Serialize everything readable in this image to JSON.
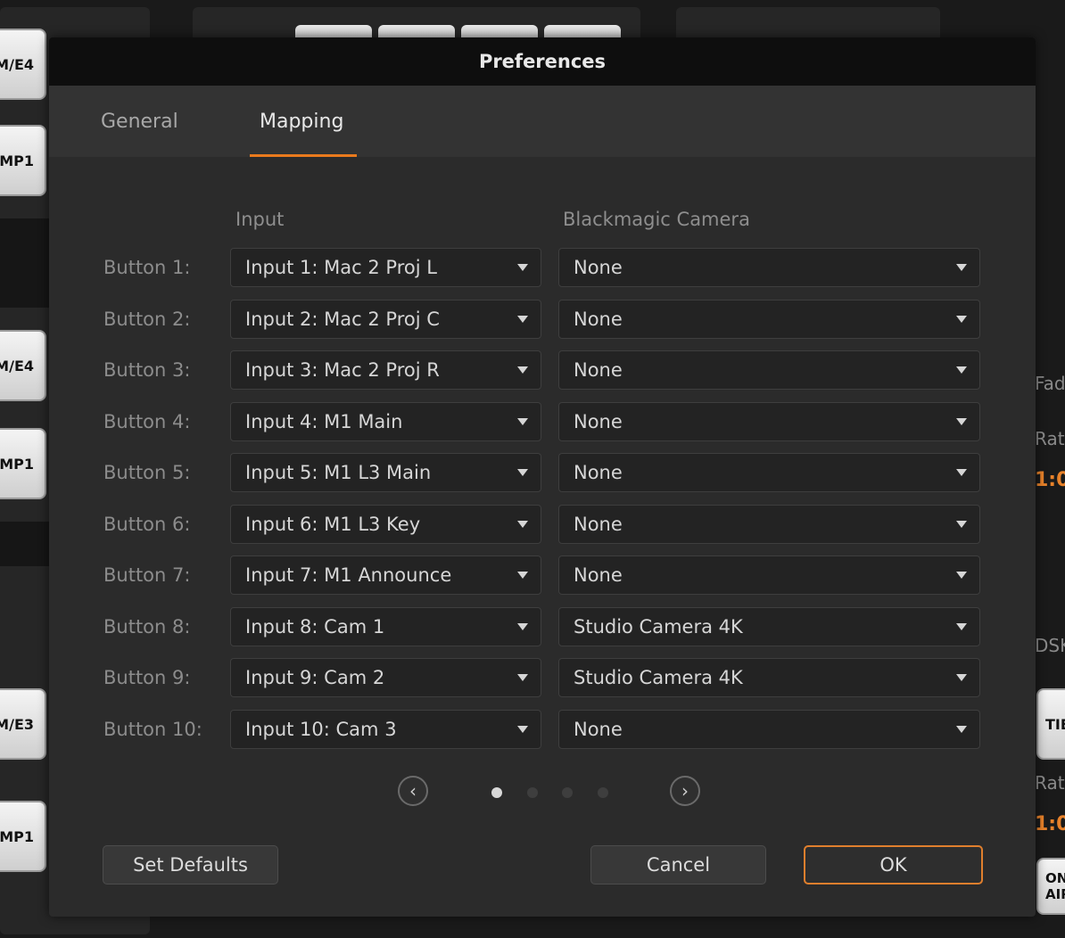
{
  "background": {
    "left_buttons": [
      "M/E4",
      "MP1",
      "M/E4",
      "MP1",
      "M/E3",
      "MP1"
    ],
    "right_labels": [
      "Fad",
      "Rat",
      "DSK",
      "Rat"
    ],
    "right_values": [
      "1:0",
      "1:0"
    ],
    "right_buttons": [
      "TIE",
      "ON AIR"
    ]
  },
  "dialog": {
    "title": "Preferences",
    "tabs": [
      {
        "label": "General",
        "active": false
      },
      {
        "label": "Mapping",
        "active": true
      }
    ],
    "columns": {
      "input": "Input",
      "camera": "Blackmagic Camera"
    },
    "rows": [
      {
        "label": "Button 1:",
        "input": "Input 1: Mac 2 Proj L",
        "camera": "None"
      },
      {
        "label": "Button 2:",
        "input": "Input 2: Mac 2 Proj C",
        "camera": "None"
      },
      {
        "label": "Button 3:",
        "input": "Input 3: Mac 2 Proj R",
        "camera": "None"
      },
      {
        "label": "Button 4:",
        "input": "Input 4: M1 Main",
        "camera": "None"
      },
      {
        "label": "Button 5:",
        "input": "Input 5: M1 L3 Main",
        "camera": "None"
      },
      {
        "label": "Button 6:",
        "input": "Input 6: M1 L3 Key",
        "camera": "None"
      },
      {
        "label": "Button 7:",
        "input": "Input 7: M1 Announce",
        "camera": "None"
      },
      {
        "label": "Button 8:",
        "input": "Input 8: Cam 1",
        "camera": "Studio Camera 4K"
      },
      {
        "label": "Button 9:",
        "input": "Input 9: Cam 2",
        "camera": "Studio Camera 4K"
      },
      {
        "label": "Button 10:",
        "input": "Input 10: Cam 3",
        "camera": "None"
      }
    ],
    "pagination": {
      "current": 1,
      "total": 4,
      "prev_icon": "chevron-left-icon",
      "next_icon": "chevron-right-icon"
    },
    "buttons": {
      "set_defaults": "Set Defaults",
      "cancel": "Cancel",
      "ok": "OK"
    },
    "colors": {
      "accent": "#ea7a1d",
      "titlebar": "#0e0e0e",
      "dialog": "#2b2b2b"
    }
  }
}
